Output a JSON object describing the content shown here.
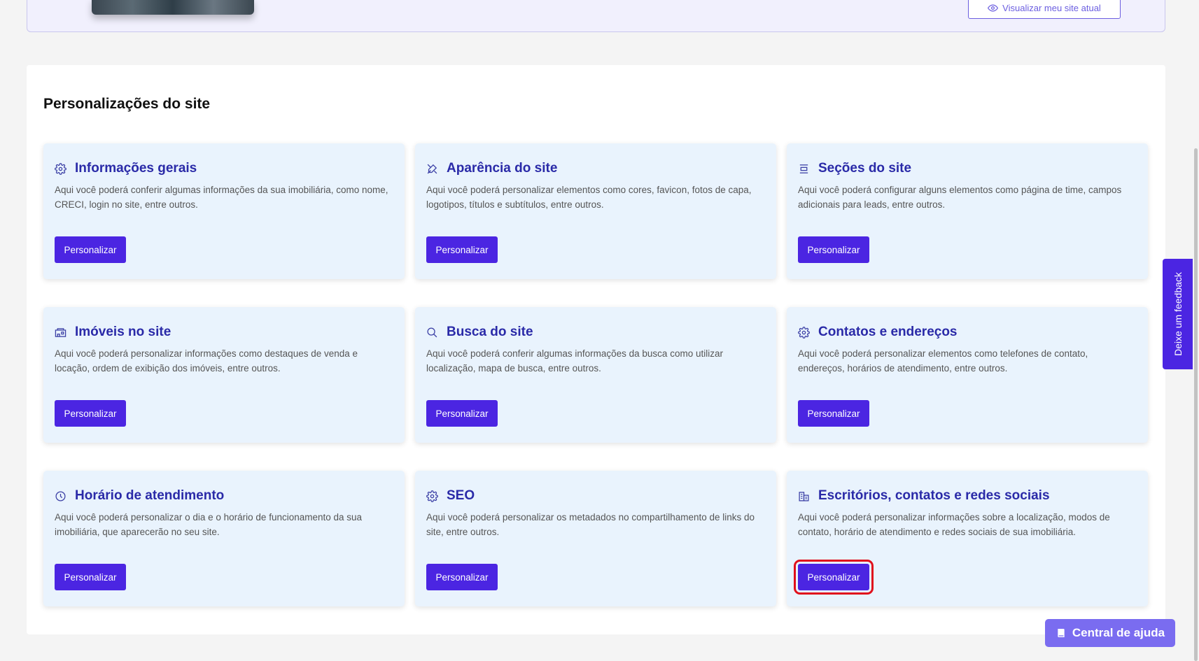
{
  "header": {
    "view_site_label": "Visualizar meu site atual"
  },
  "section": {
    "title": "Personalizações do site"
  },
  "cards": [
    {
      "title": "Informações gerais",
      "icon": "gear-icon",
      "desc": "Aqui você poderá conferir algumas informações da sua imobiliária, como nome, CRECI, login no site, entre outros.",
      "button": "Personalizar"
    },
    {
      "title": "Aparência do site",
      "icon": "design-tools-icon",
      "desc": "Aqui você poderá personalizar elementos como cores, favicon, fotos de capa, logotipos, títulos e subtítulos, entre outros.",
      "button": "Personalizar"
    },
    {
      "title": "Seções do site",
      "icon": "sections-icon",
      "desc": "Aqui você poderá configurar alguns elementos como página de time, campos adicionais para leads, entre outros.",
      "button": "Personalizar"
    },
    {
      "title": "Imóveis no site",
      "icon": "property-icon",
      "desc": "Aqui você poderá personalizar informações como destaques de venda e locação, ordem de exibição dos imóveis, entre outros.",
      "button": "Personalizar"
    },
    {
      "title": "Busca do site",
      "icon": "search-icon",
      "desc": "Aqui você poderá conferir algumas informações da busca como utilizar localização, mapa de busca, entre outros.",
      "button": "Personalizar"
    },
    {
      "title": "Contatos e endereços",
      "icon": "gear-icon",
      "desc": "Aqui você poderá personalizar elementos como telefones de contato, endereços, horários de atendimento, entre outros.",
      "button": "Personalizar"
    },
    {
      "title": "Horário de atendimento",
      "icon": "clock-icon",
      "desc": "Aqui você poderá personalizar o dia e o horário de funcionamento da sua imobiliária, que aparecerão no seu site.",
      "button": "Personalizar"
    },
    {
      "title": "SEO",
      "icon": "gear-icon",
      "desc": "Aqui você poderá personalizar os metadados no compartilhamento de links do site, entre outros.",
      "button": "Personalizar"
    },
    {
      "title": "Escritórios, contatos e redes sociais",
      "icon": "building-icon",
      "desc": "Aqui você poderá personalizar informações sobre a localização, modos de contato, horário de atendimento e redes sociais de sua imobiliária.",
      "button": "Personalizar"
    }
  ],
  "feedback": {
    "label": "Deixe um feedback"
  },
  "help": {
    "label": "Central de ajuda",
    "icon": "book-icon"
  },
  "colors": {
    "primary": "#4b25e2",
    "card_bg": "#e9f3fd",
    "title": "#2a2aa8",
    "highlight": "#e0101c"
  }
}
